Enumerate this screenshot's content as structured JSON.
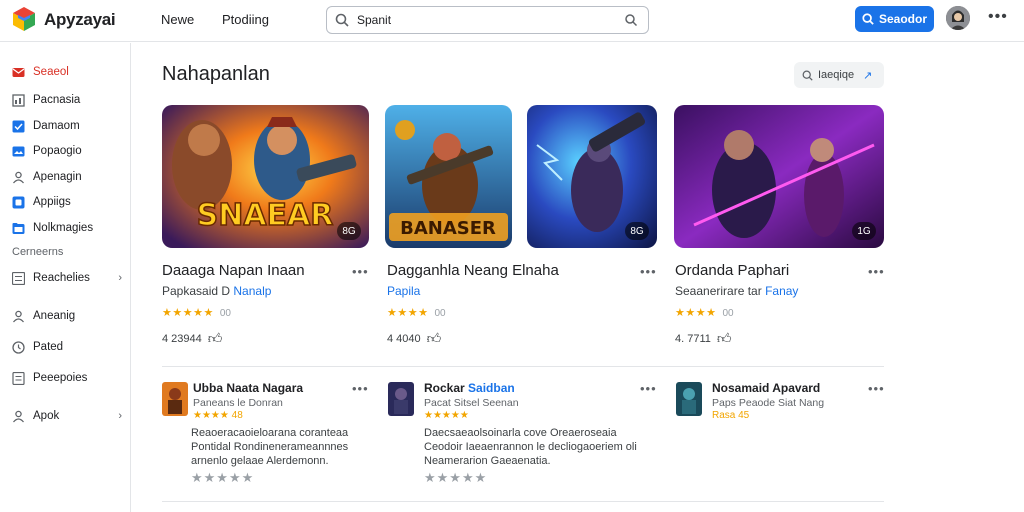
{
  "app": {
    "brand": "Apyzayai"
  },
  "nav": {
    "link1": "Newe",
    "link2": "Ptodiing"
  },
  "search": {
    "value": "Spanit"
  },
  "header_button": {
    "label": "Seaodor"
  },
  "sidebar": {
    "items": [
      {
        "label": "Seaeol",
        "icon": "mail-icon"
      },
      {
        "label": "Pacnasia",
        "icon": "chart-icon"
      },
      {
        "label": "Damaom",
        "icon": "check-box-icon"
      },
      {
        "label": "Popaogio",
        "icon": "image-icon"
      },
      {
        "label": "Apenagin",
        "icon": "person-icon"
      },
      {
        "label": "Appiigs",
        "icon": "app-icon"
      },
      {
        "label": "Nolkmagies",
        "icon": "folder-icon"
      }
    ],
    "section_label": "Cerneerns",
    "items2": [
      {
        "label": "Reachelies",
        "icon": "list-icon"
      },
      {
        "label": "Aneanig",
        "icon": "person-icon"
      },
      {
        "label": "Pated",
        "icon": "clock-icon"
      },
      {
        "label": "Peeepoies",
        "icon": "document-icon"
      },
      {
        "label": "Apok",
        "icon": "person-outline-icon"
      }
    ]
  },
  "main": {
    "title": "Nahapanlan",
    "filter": {
      "label": "Iaeqiqe"
    }
  },
  "cards": [
    {
      "art_title": "SNAEAR",
      "badge": "8G",
      "title": "Daaaga Napan Inaan",
      "dev_prefix": "Papkasaid D",
      "dev_highlight": "Nanalp",
      "rating_text": "00",
      "metric": "4  23944"
    },
    {
      "art_title": "BANASER",
      "badge": "",
      "title": "Dagganhla Neang Elnaha",
      "dev_prefix": "",
      "dev_highlight": "Papila",
      "rating_text": "00",
      "metric": "4  4040"
    },
    {
      "art_title": "",
      "badge": "8G",
      "title": "",
      "dev_prefix": "",
      "dev_highlight": "",
      "rating_text": "",
      "metric": ""
    },
    {
      "art_title": "",
      "badge": "1G",
      "title": "Ordanda Paphari",
      "dev_prefix": "Seaanerirare tar",
      "dev_highlight": "Fanay",
      "rating_text": "00",
      "metric": "4. 7711"
    }
  ],
  "list": [
    {
      "title": "Ubba Naata Nagara",
      "title_highlight": "",
      "subtitle": "Paneans le Donran",
      "stars": "★★★★ 48",
      "description": "Reaoeracaoieloarana coranteaa Pontidal Rondinenerameannnes arnenlo gelaae Alerdemonn.",
      "rate": "★★★★★"
    },
    {
      "title": "Rockar",
      "title_highlight": "Saidban",
      "subtitle": "Pacat Sitsel Seenan",
      "stars": "★★★★★",
      "description": "Daecsaeaolsoinarla cove Oreaeroseaia Ceodoir Iaeaenrannon le decliogaoeriem oli Neamerarion Gaeaenatia.",
      "rate": "★★★★★"
    },
    {
      "title": "Nosamaid Apavard",
      "title_highlight": "",
      "subtitle": "Paps Peaode Siat Nang",
      "stars": "Rasa 45",
      "description": "",
      "rate": ""
    }
  ],
  "colors": {
    "accent": "#1a73e8",
    "active": "#d93025",
    "star": "#f2a500"
  }
}
